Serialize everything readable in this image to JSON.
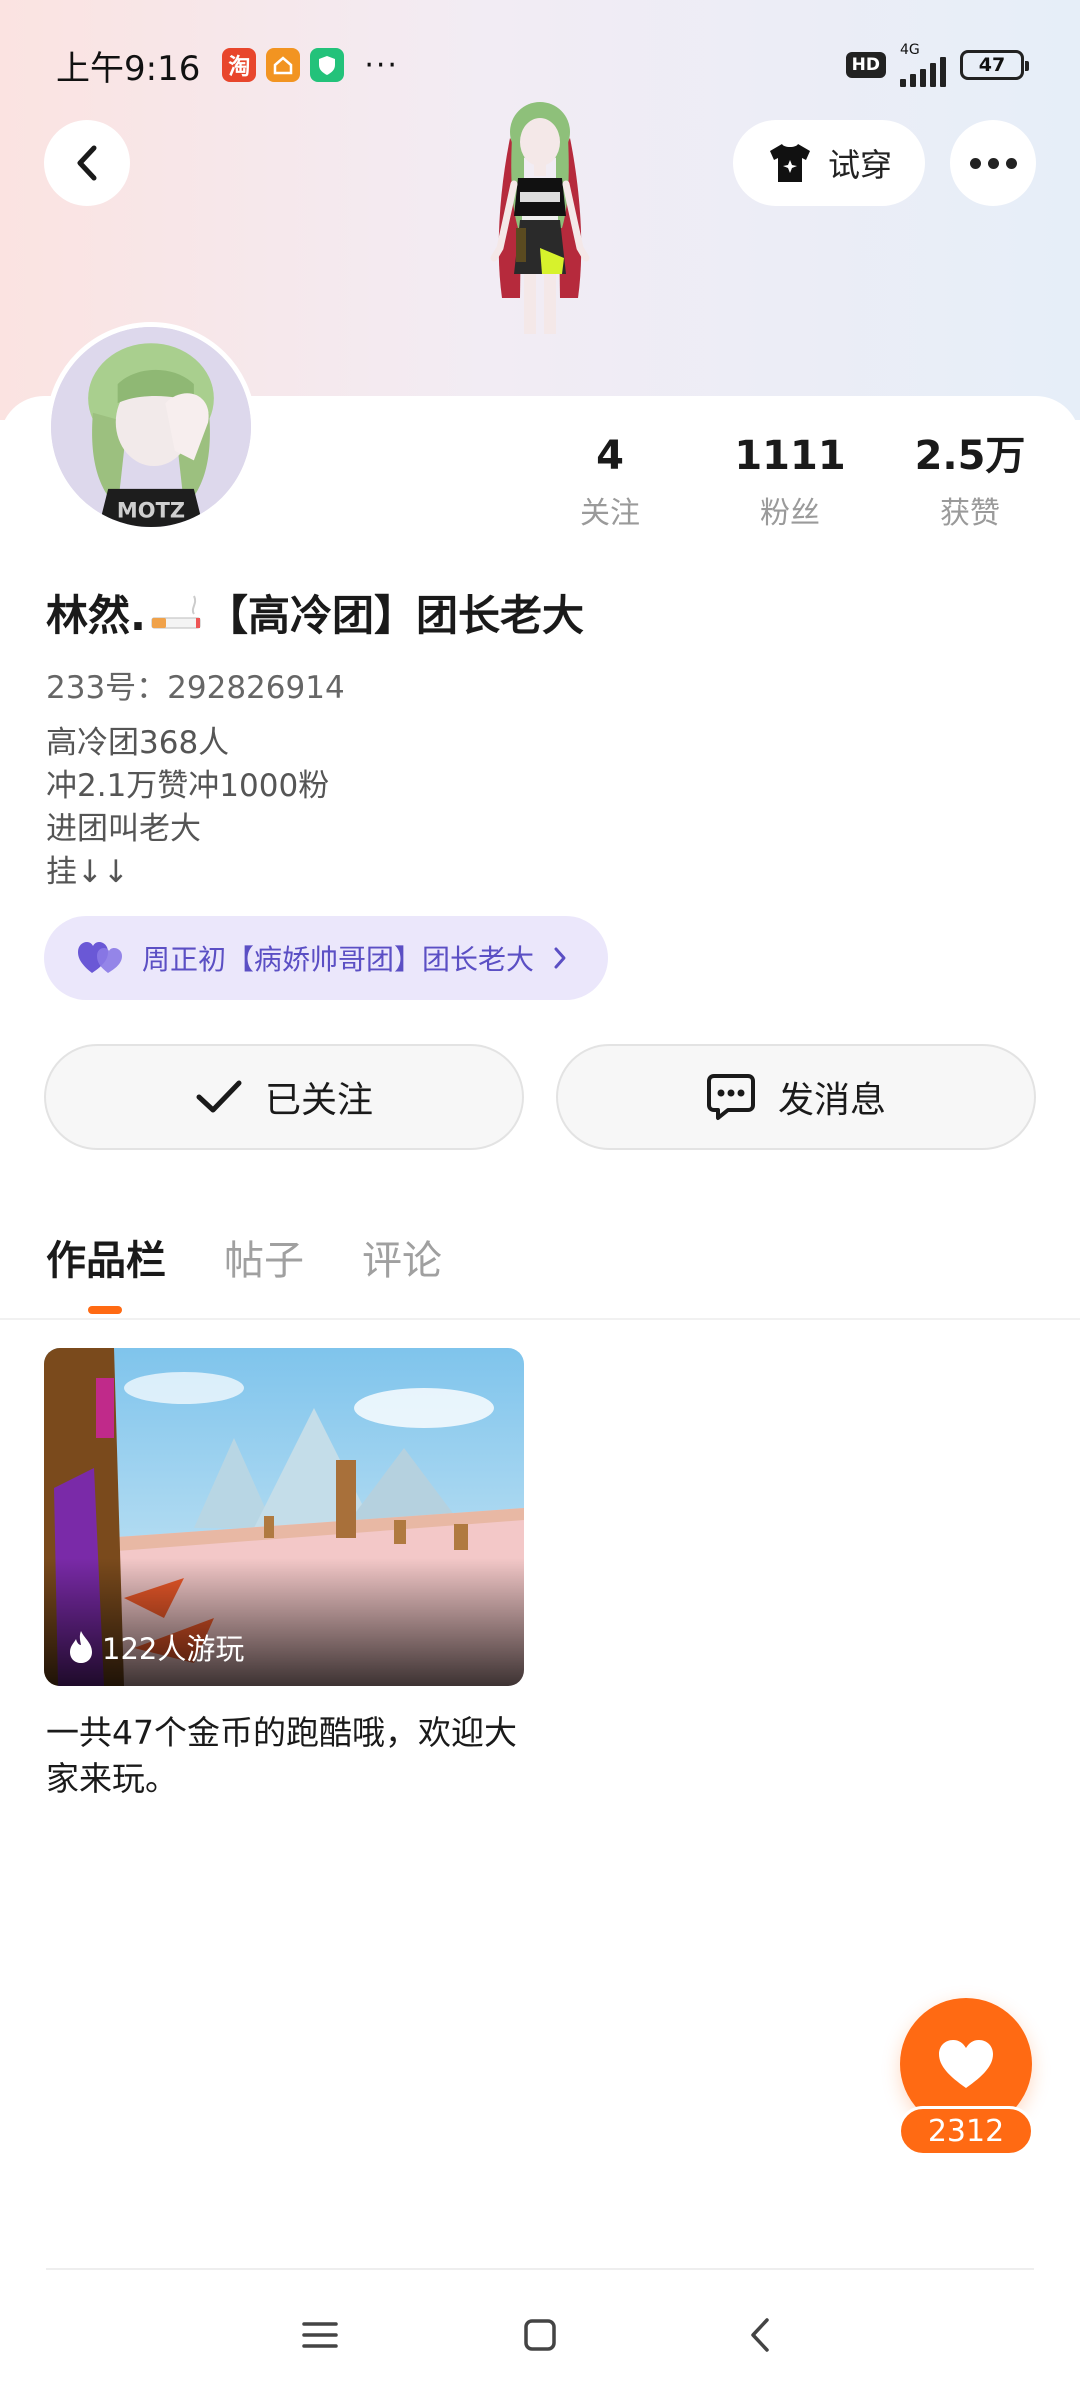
{
  "status_bar": {
    "time": "上午9:16",
    "apps": [
      "taobao-icon",
      "home-app-icon",
      "shield-app-icon"
    ],
    "more": "···",
    "hd": "HD",
    "network": "4G",
    "battery": "47"
  },
  "header": {
    "try_on_label": "试穿"
  },
  "profile": {
    "stats": [
      {
        "value": "4",
        "label": "关注"
      },
      {
        "value": "1111",
        "label": "粉丝"
      },
      {
        "value": "2.5万",
        "label": "获赞"
      }
    ],
    "name_prefix": "林然.",
    "name_suffix": "【高冷团】团长老大",
    "uid": "233号：292826914",
    "bio": [
      "高冷团368人",
      "冲2.1万赞冲1000粉",
      "进团叫老大",
      "挂↓↓"
    ],
    "fan_group": "周正初【病娇帅哥团】团长老大"
  },
  "actions": {
    "follow_label": "已关注",
    "message_label": "发消息"
  },
  "tabs": [
    {
      "label": "作品栏",
      "active": true
    },
    {
      "label": "帖子",
      "active": false
    },
    {
      "label": "评论",
      "active": false
    }
  ],
  "works": [
    {
      "plays": "122人游玩",
      "title": "一共47个金币的跑酷哦，欢迎大家来玩。"
    }
  ],
  "like": {
    "count": "2312"
  },
  "colors": {
    "accent": "#ff6a13",
    "fan_group_bg": "#ebe7fb",
    "fan_group_text": "#5b4fc4"
  }
}
